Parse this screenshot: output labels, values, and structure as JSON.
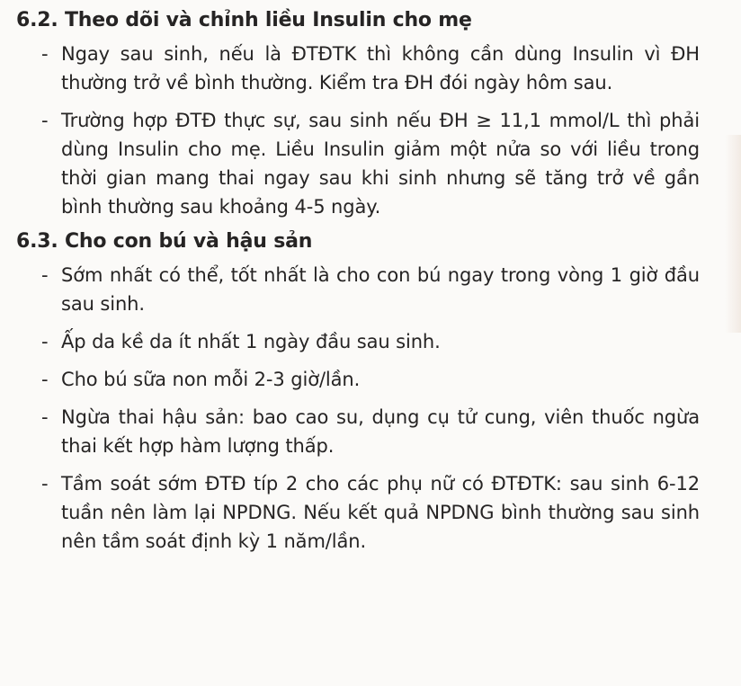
{
  "section_6_2": {
    "title": "6.2. Theo dõi và chỉnh liều Insulin cho mẹ",
    "items": [
      "Ngay sau sinh, nếu là ĐTĐTK thì không cần dùng Insulin vì ĐH thường trở về bình thường. Kiểm tra ĐH đói ngày hôm sau.",
      "Trường hợp ĐTĐ thực sự, sau sinh nếu ĐH ≥ 11,1 mmol/L thì phải dùng Insulin cho mẹ. Liều Insulin giảm một nửa so với liều trong thời gian mang thai ngay sau khi sinh nhưng sẽ tăng trở về gần bình thường sau khoảng 4-5 ngày."
    ]
  },
  "section_6_3": {
    "title": "6.3. Cho con bú và hậu sản",
    "items": [
      "Sớm nhất có thể, tốt nhất là cho con bú ngay trong vòng 1 giờ đầu sau sinh.",
      "Ấp da kề da ít nhất 1 ngày đầu sau sinh.",
      "Cho bú sữa non mỗi 2-3 giờ/lần.",
      "Ngừa thai hậu sản: bao cao su, dụng cụ tử cung, viên thuốc ngừa thai kết hợp hàm lượng thấp.",
      "Tầm soát sớm ĐTĐ típ 2 cho các phụ nữ có ĐTĐTK: sau sinh 6-12 tuần nên làm lại NPDNG. Nếu kết quả NPDNG bình thường sau sinh nên tầm soát định kỳ 1 năm/lần."
    ]
  },
  "bullet": "-"
}
